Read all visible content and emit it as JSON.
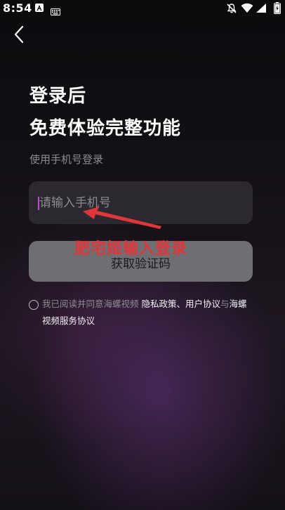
{
  "status_bar": {
    "time": "8:54",
    "icons": [
      "a-notification-icon",
      "keyboard-icon",
      "bell-muted-icon",
      "wifi-icon",
      "signal-icon",
      "battery-icon"
    ]
  },
  "header": {
    "back_icon": "chevron-left-icon"
  },
  "main": {
    "headline_line1": "登录后",
    "headline_line2": "免费体验完整功能",
    "subtitle": "使用手机号登录",
    "phone_placeholder": "请输入手机号",
    "get_code_label": "获取验证码"
  },
  "annotation": {
    "text": "肥宅姬输入登录",
    "color": "#e0363a"
  },
  "agreement": {
    "prefix": "我已阅读并同意海螺视频 ",
    "privacy_policy": "隐私政策",
    "sep1": "、",
    "user_agreement": "用户协议",
    "sep2": "与",
    "service_agreement_part1": "海螺",
    "service_agreement_part2": "视频服务协议"
  },
  "colors": {
    "caret": "#c24bd8",
    "button_bg": "#6f6e72",
    "field_bg": "#2b292f"
  }
}
